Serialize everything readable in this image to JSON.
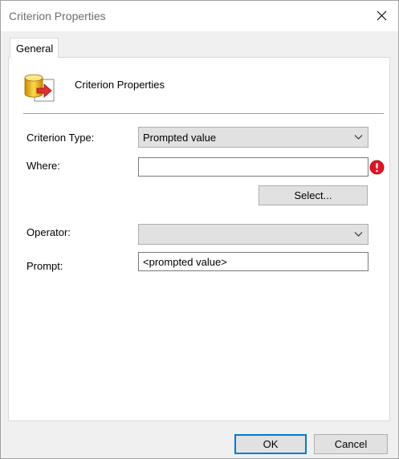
{
  "window": {
    "title": "Criterion Properties"
  },
  "tabs": [
    {
      "label": "General"
    }
  ],
  "header": {
    "label": "Criterion Properties"
  },
  "form": {
    "criterion_type": {
      "label": "Criterion Type:",
      "value": "Prompted value"
    },
    "where": {
      "label": "Where:",
      "value": ""
    },
    "select_button": "Select...",
    "operator": {
      "label": "Operator:",
      "value": ""
    },
    "prompt": {
      "label": "Prompt:",
      "value": "<prompted value>"
    }
  },
  "footer": {
    "ok_label": "OK",
    "cancel_label": "Cancel"
  },
  "colors": {
    "accent": "#0078d7",
    "error": "#e81123"
  },
  "icons": [
    "close-icon",
    "database-arrow-icon",
    "chevron-down-icon",
    "error-icon"
  ]
}
